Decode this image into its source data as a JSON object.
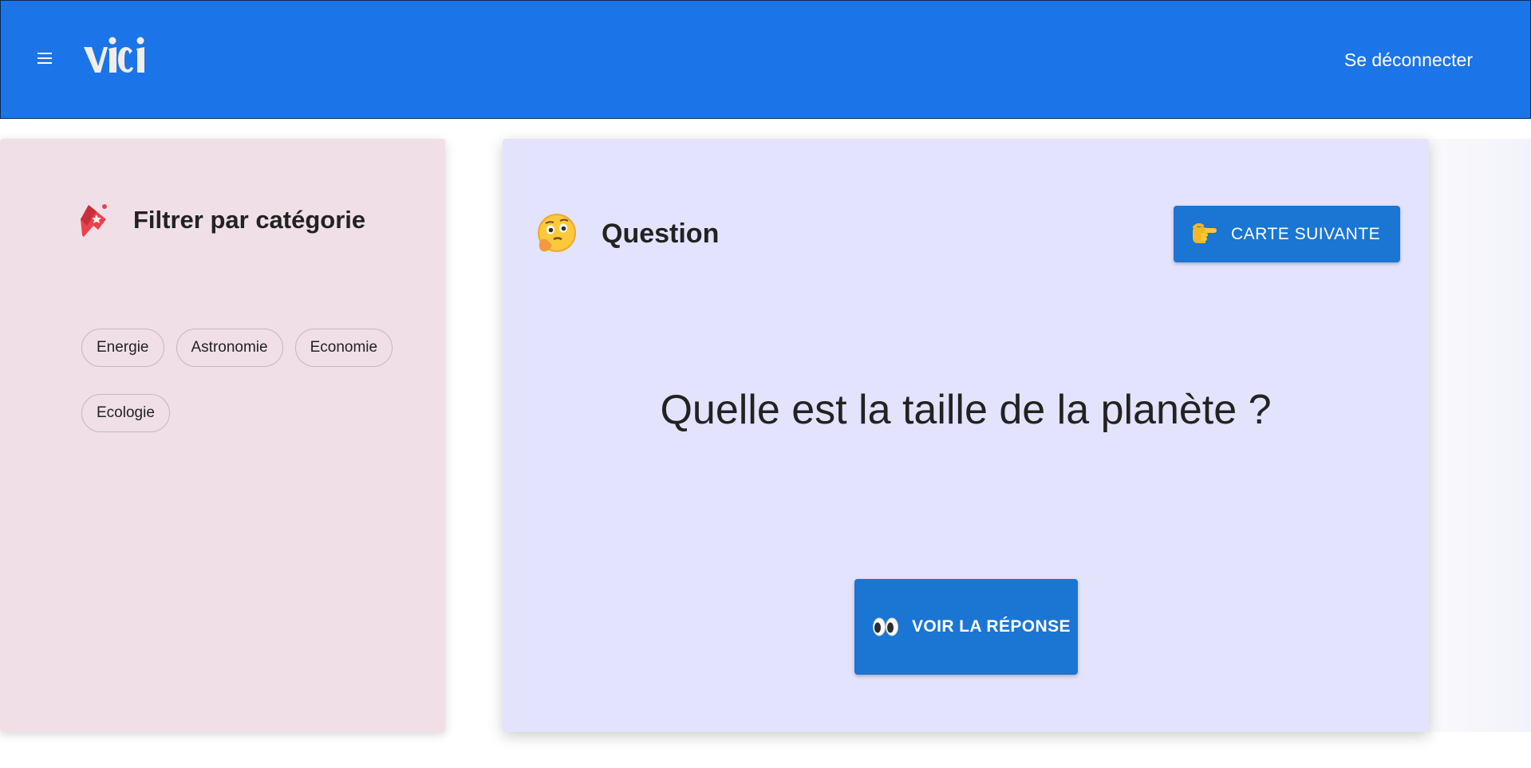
{
  "header": {
    "menu_icon": "hamburger-menu-icon",
    "logo_text": "vici",
    "logout_label": "Se déconnecter",
    "background_color": "#1c75e8"
  },
  "filter_panel": {
    "icon": "bookmark-tag-icon",
    "title": "Filtrer par catégorie",
    "categories": [
      "Energie",
      "Astronomie",
      "Economie",
      "Ecologie"
    ],
    "background_color": "#f1dfe8"
  },
  "question_card": {
    "icon": "thinking-face-icon",
    "label": "Question",
    "next_button": {
      "icon": "pointing-hand-icon",
      "label": "CARTE SUIVANTE"
    },
    "question_text": "Quelle est la taille de la planète ?",
    "answer_button": {
      "icon": "eyes-icon",
      "label": "VOIR LA RÉPONSE"
    },
    "background_color": "#e3e3fd",
    "button_color": "#1a76d2"
  }
}
